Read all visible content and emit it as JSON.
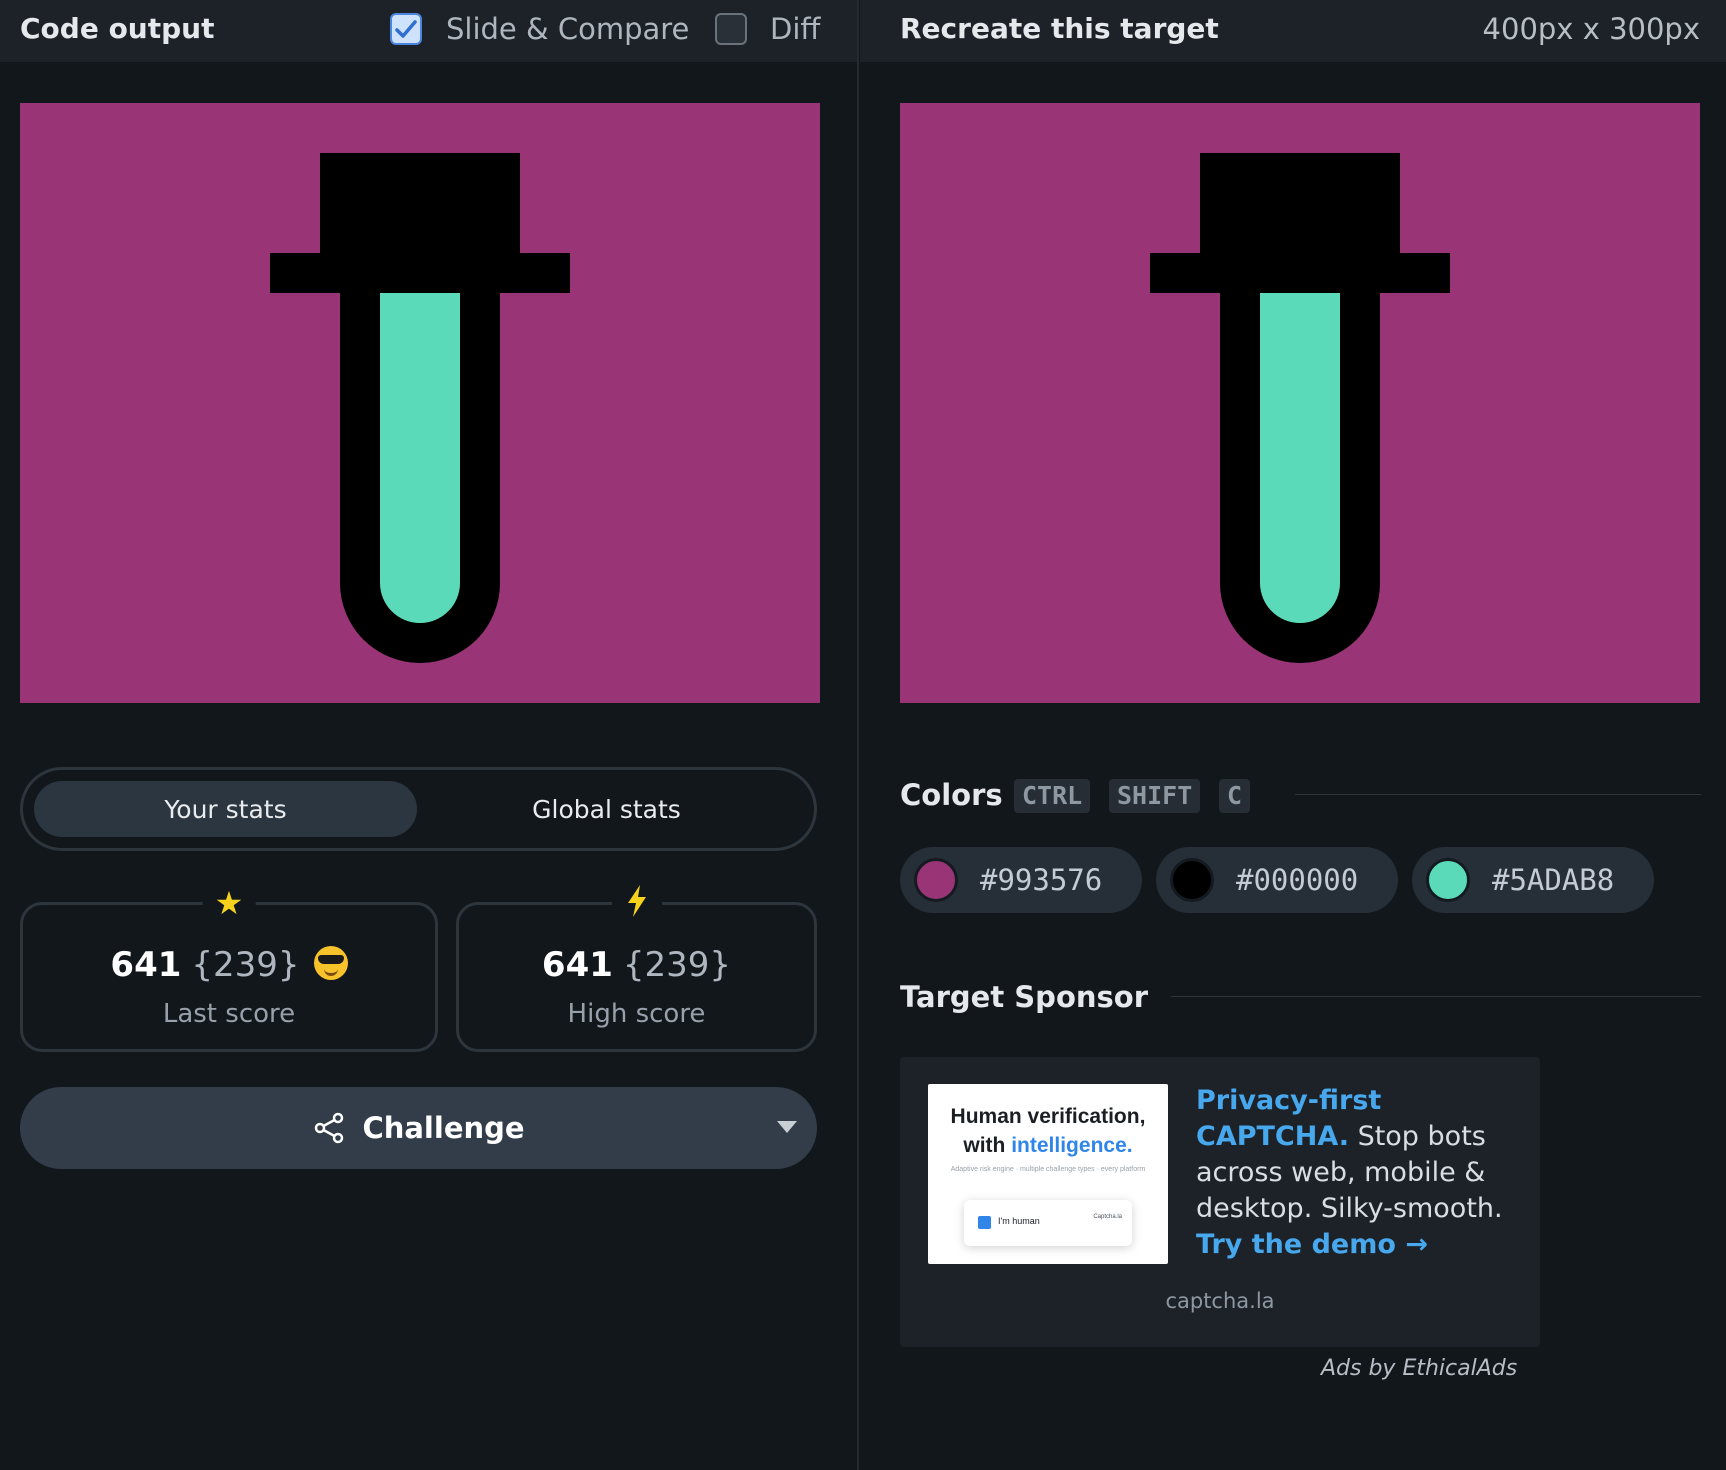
{
  "left_header": {
    "title": "Code output",
    "slide_compare_label": "Slide & Compare",
    "slide_compare_checked": true,
    "diff_label": "Diff",
    "diff_checked": false
  },
  "right_header": {
    "title": "Recreate this target",
    "dimensions": "400px x 300px"
  },
  "stats_toggle": {
    "your_stats": "Your stats",
    "global_stats": "Global stats",
    "active": "your_stats"
  },
  "last_score": {
    "score": "641",
    "sub": "{239}",
    "label": "Last score",
    "icon": "star-icon",
    "emoji": "smiling-face-with-sunglasses"
  },
  "high_score": {
    "score": "641",
    "sub": "{239}",
    "label": "High score",
    "icon": "lightning-icon"
  },
  "challenge": {
    "label": "Challenge",
    "icon": "share-icon"
  },
  "colors": {
    "title": "Colors",
    "shortcut": [
      "CTRL",
      "SHIFT",
      "C"
    ],
    "swatches": [
      {
        "hex": "#993576",
        "color": "#993576"
      },
      {
        "hex": "#000000",
        "color": "#000000"
      },
      {
        "hex": "#5ADAB8",
        "color": "#5ADAB8"
      }
    ]
  },
  "sponsor": {
    "title": "Target Sponsor",
    "image_title_line1": "Human verification,",
    "image_title_line2a": "with ",
    "image_title_line2b": "intelligence.",
    "image_sub": "Adaptive risk engine  ·  multiple challenge types  ·  every platform",
    "image_card_label": "I'm human",
    "image_card_brand": "Captcha.la",
    "headline": "Privacy-first CAPTCHA.",
    "body": " Stop bots across web, mobile & desktop. Silky-smooth. ",
    "cta": "Try the demo →",
    "domain": "captcha.la",
    "credit": "Ads by EthicalAds"
  },
  "target_colors": {
    "background": "#993576",
    "outline": "#000000",
    "liquid": "#5ADAB8"
  }
}
